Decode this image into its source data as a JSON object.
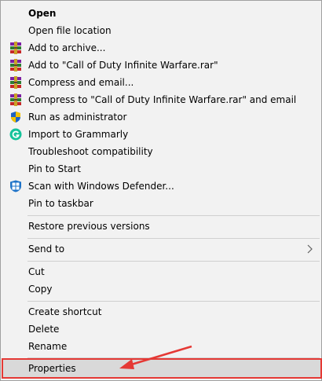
{
  "menu": {
    "items": [
      {
        "id": "open",
        "label": "Open",
        "bold": true,
        "icon": null
      },
      {
        "id": "open-file-location",
        "label": "Open file location",
        "icon": null
      },
      {
        "id": "add-to-archive",
        "label": "Add to archive...",
        "icon": "winrar-icon"
      },
      {
        "id": "add-to-rar",
        "label": "Add to \"Call of Duty Infinite Warfare.rar\"",
        "icon": "winrar-icon"
      },
      {
        "id": "compress-and-email",
        "label": "Compress and email...",
        "icon": "winrar-icon"
      },
      {
        "id": "compress-to-rar-and-email",
        "label": "Compress to \"Call of Duty Infinite Warfare.rar\" and email",
        "icon": "winrar-icon"
      },
      {
        "id": "run-as-administrator",
        "label": "Run as administrator",
        "icon": "uac-shield-icon"
      },
      {
        "id": "import-to-grammarly",
        "label": "Import to Grammarly",
        "icon": "grammarly-icon"
      },
      {
        "id": "troubleshoot-compatibility",
        "label": "Troubleshoot compatibility",
        "icon": null
      },
      {
        "id": "pin-to-start",
        "label": "Pin to Start",
        "icon": null
      },
      {
        "id": "scan-with-defender",
        "label": "Scan with Windows Defender...",
        "icon": "windows-defender-icon"
      },
      {
        "id": "pin-to-taskbar",
        "label": "Pin to taskbar",
        "icon": null
      },
      {
        "id": "restore-previous-versions",
        "label": "Restore previous versions",
        "icon": null
      },
      {
        "id": "send-to",
        "label": "Send to",
        "icon": null,
        "submenu": true
      },
      {
        "id": "cut",
        "label": "Cut",
        "icon": null
      },
      {
        "id": "copy",
        "label": "Copy",
        "icon": null
      },
      {
        "id": "create-shortcut",
        "label": "Create shortcut",
        "icon": null
      },
      {
        "id": "delete",
        "label": "Delete",
        "icon": null
      },
      {
        "id": "rename",
        "label": "Rename",
        "icon": null
      },
      {
        "id": "properties",
        "label": "Properties",
        "icon": null,
        "highlighted": true
      }
    ]
  },
  "colors": {
    "menu_bg": "#f2f2f2",
    "highlight": "#d9d9d9",
    "annotation": "#e53935"
  }
}
